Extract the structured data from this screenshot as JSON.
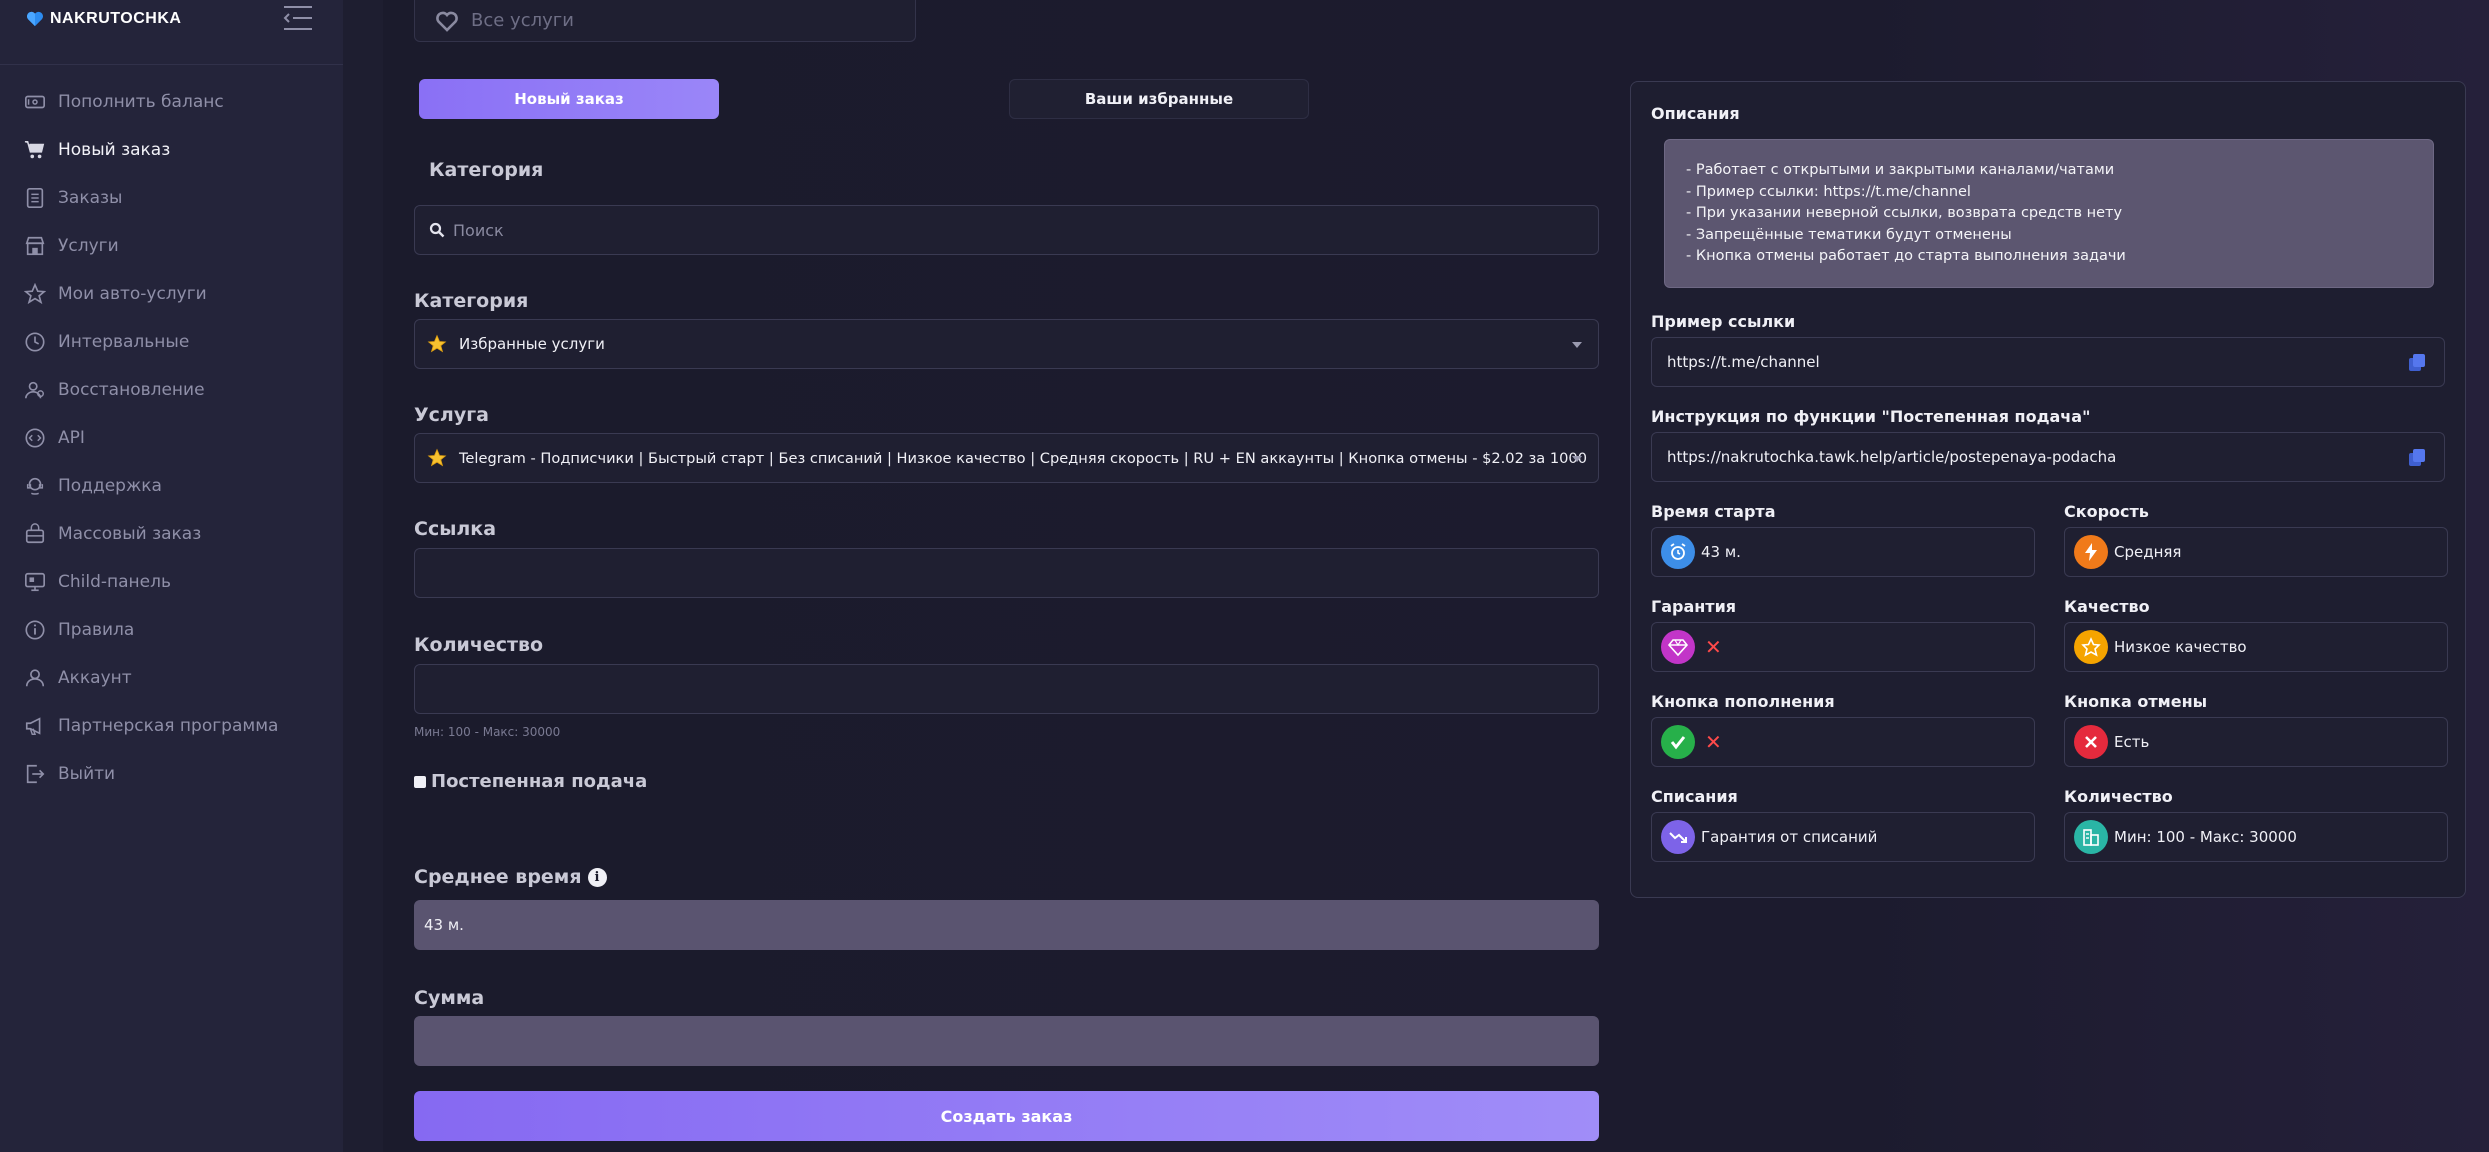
{
  "app": {
    "logo_text": "NAKRUTOCHKA"
  },
  "sidebar": {
    "items": [
      {
        "label": "Пополнить баланс",
        "icon": "wallet-icon"
      },
      {
        "label": "Новый заказ",
        "icon": "cart-icon"
      },
      {
        "label": "Заказы",
        "icon": "list-icon"
      },
      {
        "label": "Услуги",
        "icon": "store-icon"
      },
      {
        "label": "Мои авто-услуги",
        "icon": "star-icon"
      },
      {
        "label": "Интервальные",
        "icon": "clock-icon"
      },
      {
        "label": "Восстановление",
        "icon": "users-icon"
      },
      {
        "label": "API",
        "icon": "code-icon"
      },
      {
        "label": "Поддержка",
        "icon": "support-icon"
      },
      {
        "label": "Массовый заказ",
        "icon": "bulk-icon"
      },
      {
        "label": "Child-панель",
        "icon": "monitor-icon"
      },
      {
        "label": "Правила",
        "icon": "info-icon"
      },
      {
        "label": "Аккаунт",
        "icon": "user-icon"
      },
      {
        "label": "Партнерская программа",
        "icon": "megaphone-icon"
      },
      {
        "label": "Выйти",
        "icon": "logout-icon"
      }
    ]
  },
  "filter": {
    "all_services": "Все услуги"
  },
  "tabs": {
    "new_order": "Новый заказ",
    "favorites": "Ваши избранные"
  },
  "form": {
    "category_heading": "Категория",
    "search_placeholder": "Поиск",
    "category_label": "Категория",
    "category_value": "Избранные услуги",
    "service_label": "Услуга",
    "service_value": "Telegram - Подписчики | Быстрый старт | Без списаний | Низкое качество | Средняя скорость | RU + EN аккаунты | Кнопка отмены - $2.02 за 1000",
    "link_label": "Ссылка",
    "link_value": "",
    "quantity_label": "Количество",
    "quantity_value": "",
    "quantity_hint": "Мин: 100 - Макс: 30000",
    "drip_feed_label": "Постепенная подача",
    "avg_time_label": "Среднее время",
    "avg_time_value": "43 м.",
    "sum_label": "Сумма",
    "sum_value": "",
    "submit_label": "Создать заказ"
  },
  "panel": {
    "description_title": "Описания",
    "description_lines": [
      "- Работает с открытыми и закрытыми каналами/чатами",
      "- Пример ссылки: https://t.me/channel",
      "- При указании неверной ссылки, возврата средств нету",
      "- Запрещённые тематики будут отменены",
      "- Кнопка отмены работает до старта выполнения задачи"
    ],
    "example_link_label": "Пример ссылки",
    "example_link_value": "https://t.me/channel",
    "instruction_label": "Инструкция по функции \"Постепенная подача\"",
    "instruction_value": "https://nakrutochka.tawk.help/article/postepenaya-podacha",
    "start_time_label": "Время старта",
    "start_time_value": "43 м.",
    "speed_label": "Скорость",
    "speed_value": "Средняя",
    "guarantee_label": "Гарантия",
    "quality_label": "Качество",
    "quality_value": "Низкое качество",
    "refill_label": "Кнопка пополнения",
    "cancel_label": "Кнопка отмены",
    "cancel_value": "Есть",
    "drops_label": "Списания",
    "drops_value": "Гарантия от списаний",
    "quantity_label": "Количество",
    "quantity_value": "Мин: 100 - Макс: 30000",
    "no_mark": "✕"
  },
  "colors": {
    "accent": "#8a70f5",
    "badge_blue": "#3d8ee8",
    "badge_orange": "#f07a1a",
    "badge_magenta": "#c235c8",
    "badge_amber": "#f5a400",
    "badge_green": "#27b04a",
    "badge_red": "#e52a3d",
    "badge_violet": "#7d63e8",
    "badge_teal": "#2ab5a5"
  }
}
